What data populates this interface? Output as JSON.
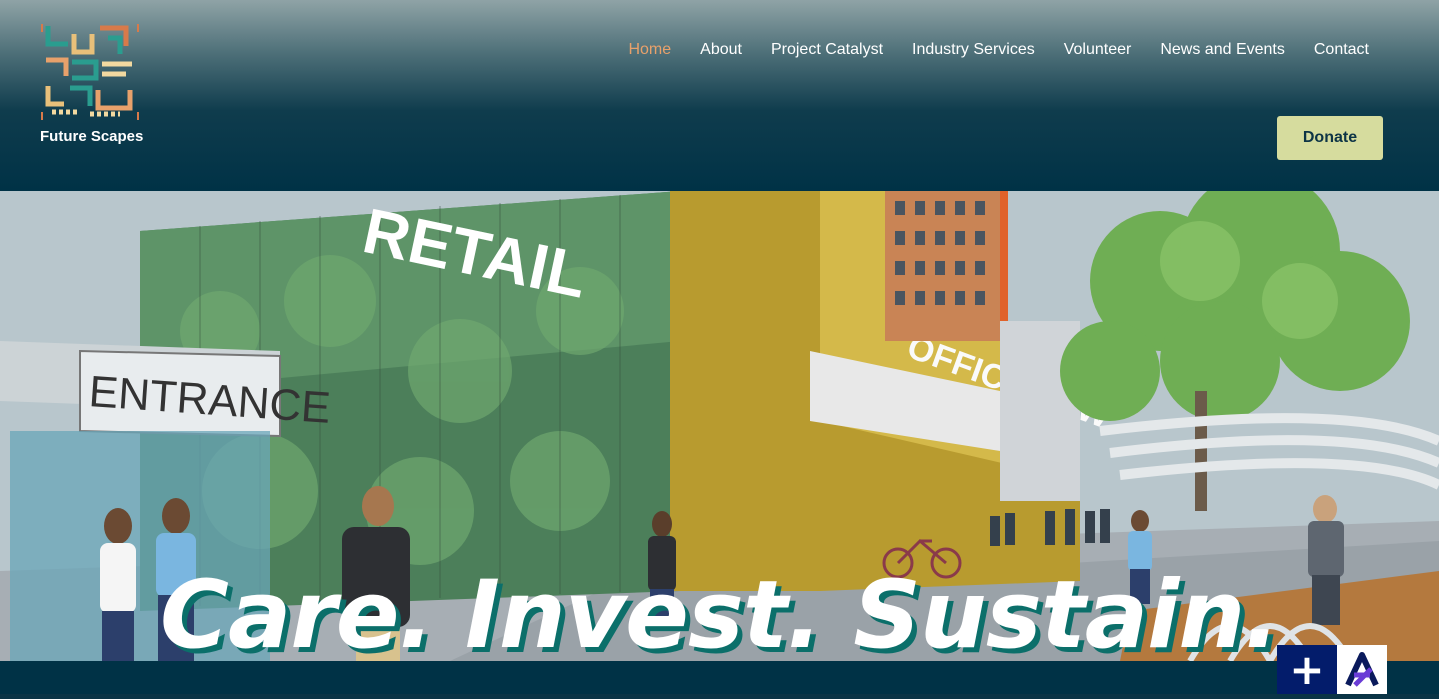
{
  "brand": {
    "name": "Future Scapes",
    "logo_icon": "future-scapes-logo-icon"
  },
  "nav": {
    "items": [
      {
        "label": "Home",
        "active": true
      },
      {
        "label": "About",
        "active": false
      },
      {
        "label": "Project Catalyst",
        "active": false
      },
      {
        "label": "Industry Services",
        "active": false
      },
      {
        "label": "Volunteer",
        "active": false
      },
      {
        "label": "News and Events",
        "active": false
      },
      {
        "label": "Contact",
        "active": false
      }
    ],
    "donate_label": "Donate"
  },
  "hero": {
    "tagline": "Care. Invest. Sustain.",
    "sign_retail": "RETAIL",
    "sign_entrance": "ENTRANCE",
    "sign_office": "OFFICE TOW"
  },
  "widgets": {
    "plus_symbol": "+",
    "accessibility_icon": "accessibility-a-icon"
  },
  "colors": {
    "header_bg": "#003246",
    "nav_active": "#e8a16b",
    "donate_bg": "#d6dc9e",
    "tagline_shadow": "#0b6f6a"
  }
}
